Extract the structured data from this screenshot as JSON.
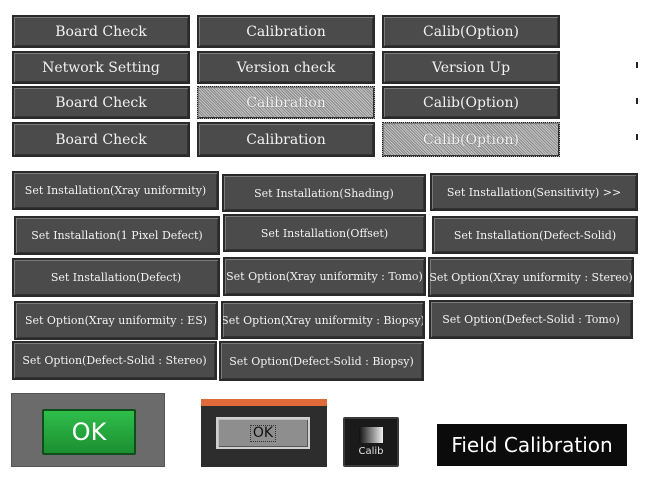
{
  "top_menu": {
    "row1": [
      "Board Check",
      "Calibration",
      "Calib(Option)"
    ],
    "row2": [
      "Network Setting",
      "Version check",
      "Version Up"
    ],
    "row3": [
      "Board Check",
      "Calibration",
      "Calib(Option)"
    ],
    "row4": [
      "Board Check",
      "Calibration",
      "Calib(Option)"
    ]
  },
  "install_buttons": [
    "Set Installation(Xray uniformity)",
    "Set Installation(Shading)",
    "Set Installation(Sensitivity) >>",
    "Set Installation(1 Pixel Defect)",
    "Set Installation(Offset)",
    "Set Installation(Defect-Solid)",
    "Set Installation(Defect)",
    "Set Option(Xray uniformity : Tomo)",
    "Set Option(Xray uniformity : Stereo)",
    "Set Option(Xray uniformity : ES)",
    "Set Option(Xray uniformity : Biopsy)",
    "Set Option(Defect-Solid : Tomo)",
    "Set Option(Defect-Solid : Stereo)",
    "Set Option(Defect-Solid : Biopsy)"
  ],
  "bottom": {
    "ok_green": "OK",
    "dialog_ok": "OK",
    "calib_label": "Calib",
    "field_calibration": "Field Calibration"
  },
  "colors": {
    "button_bg": "#4b4b4b",
    "ok_green": "#23a83c",
    "dialog_accent": "#e06a3a",
    "field_calib_bg": "#0b0b0b"
  }
}
